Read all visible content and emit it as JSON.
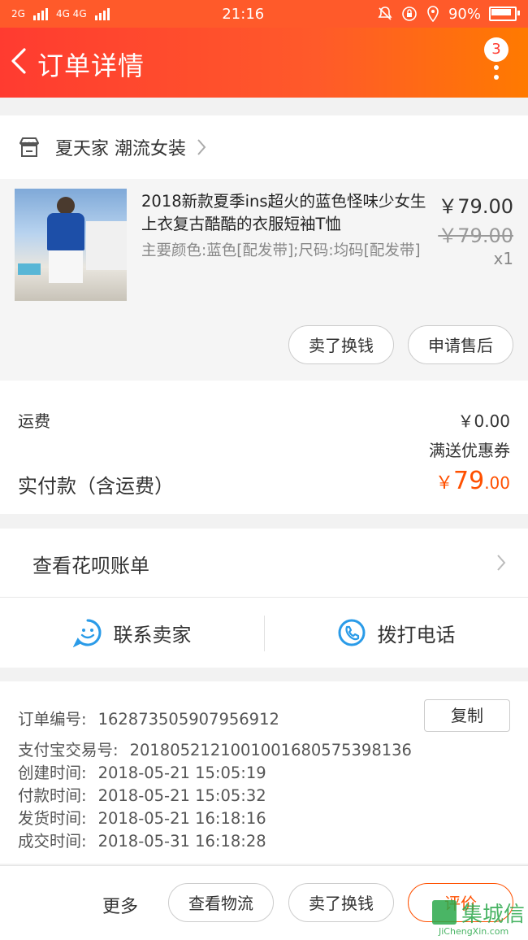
{
  "status_bar": {
    "left_net1": "2G",
    "left_net2": "4G 4G",
    "time": "21:16",
    "battery": "90%"
  },
  "header": {
    "title": "订单详情",
    "badge_count": "3"
  },
  "shop": {
    "name": "夏天家 潮流女装"
  },
  "item": {
    "title": "2018新款夏季ins超火的蓝色怪味少女生上衣复古酷酷的衣服短袖T恤",
    "spec": "主要颜色:蓝色[配发带];尺码:均码[配发带]",
    "price": "￥79.00",
    "original_price": "￥79.00",
    "quantity": "x1",
    "sell_button": "卖了换钱",
    "after_sales_button": "申请售后"
  },
  "fees": {
    "shipping_label": "运费",
    "shipping_value": "￥0.00",
    "coupon_text": "满送优惠券",
    "paid_label": "实付款（含运费）",
    "paid_currency": "￥",
    "paid_integer": "79",
    "paid_decimal": ".00"
  },
  "huabei": {
    "label": "查看花呗账单"
  },
  "contact": {
    "seller": "联系卖家",
    "phone": "拨打电话"
  },
  "order_info": {
    "order_no_label": "订单编号:",
    "order_no": "162873505907956912",
    "copy_button": "复制",
    "alipay_label": "支付宝交易号:",
    "alipay_no": "2018052121001001680575398136",
    "created_label": "创建时间:",
    "created": "2018-05-21 15:05:19",
    "paid_label": "付款时间:",
    "paid": "2018-05-21 15:05:32",
    "shipped_label": "发货时间:",
    "shipped": "2018-05-21 16:18:16",
    "completed_label": "成交时间:",
    "completed": "2018-05-31 16:18:28"
  },
  "bottom_bar": {
    "more": "更多",
    "logistics": "查看物流",
    "sell": "卖了换钱",
    "review": "评价"
  },
  "watermark": {
    "brand": "集城信",
    "url": "JiChengXin.com"
  },
  "colors": {
    "header_start": "#ff3b30",
    "header_end": "#ff7a00",
    "accent_price": "#ff5000",
    "link_blue": "#2a9be8"
  },
  "icons": {
    "back": "chevron-left-icon",
    "more": "more-vertical-icon",
    "shop": "store-icon",
    "chevron": "chevron-right-icon",
    "chat": "chat-smile-icon",
    "phone": "phone-icon"
  }
}
